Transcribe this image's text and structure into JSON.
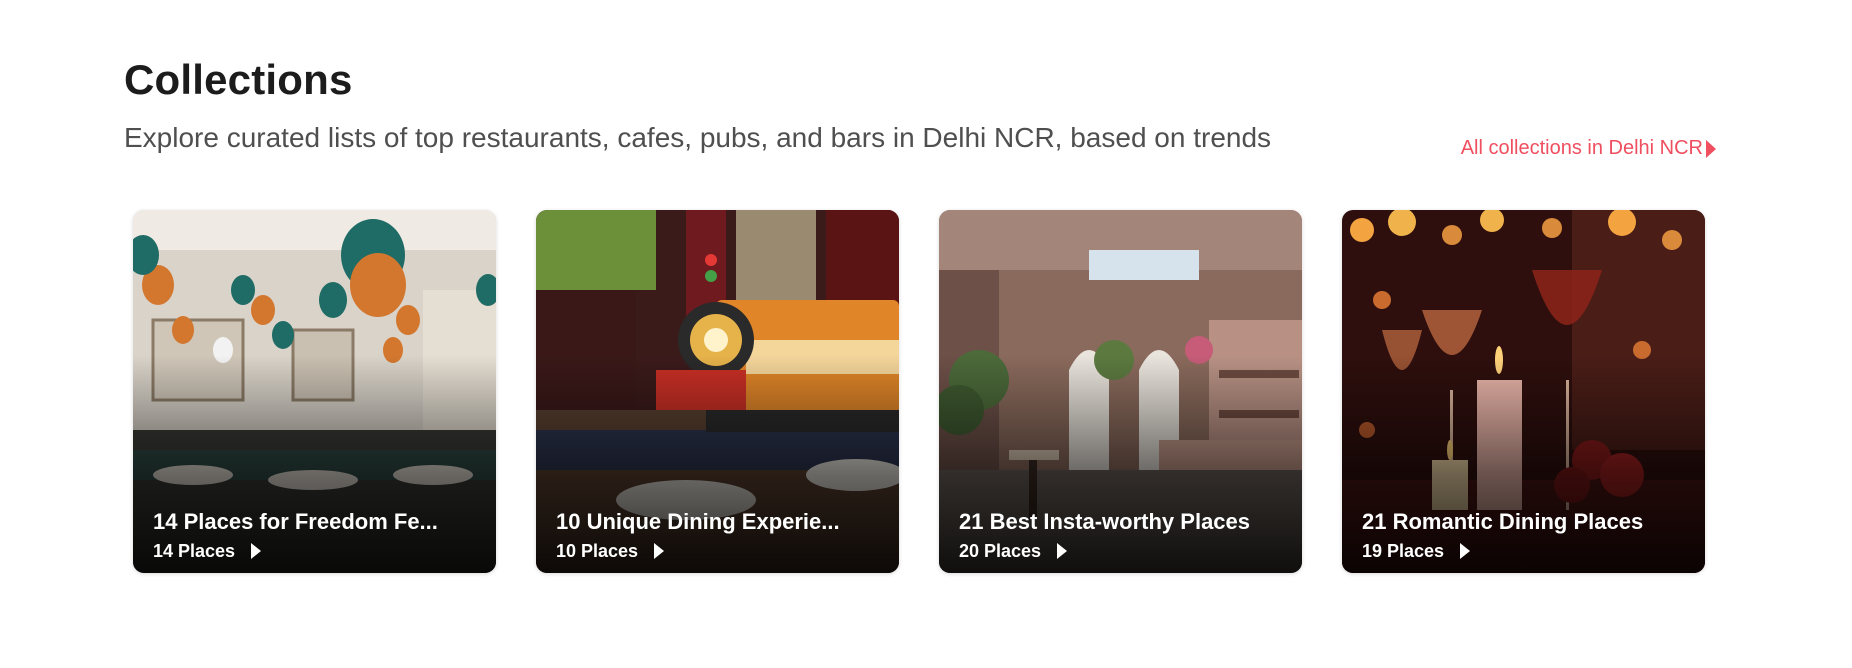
{
  "section": {
    "title": "Collections",
    "subtitle": "Explore curated lists of top restaurants, cafes, pubs, and bars in Delhi NCR, based on trends",
    "all_link": "All collections in Delhi NCR",
    "link_color": "#ef4f5f"
  },
  "cards": [
    {
      "title": "14 Places for Freedom Fe...",
      "count": "14 Places",
      "image": "restaurant-with-tricolor-balloons"
    },
    {
      "title": "10 Unique Dining Experie...",
      "count": "10 Places",
      "image": "toy-train-on-dining-table"
    },
    {
      "title": "21 Best Insta-worthy Places",
      "count": "20 Places",
      "image": "cafe-interior-with-plants"
    },
    {
      "title": "21 Romantic Dining Places",
      "count": "19 Places",
      "image": "candles-and-wine-glasses"
    }
  ]
}
